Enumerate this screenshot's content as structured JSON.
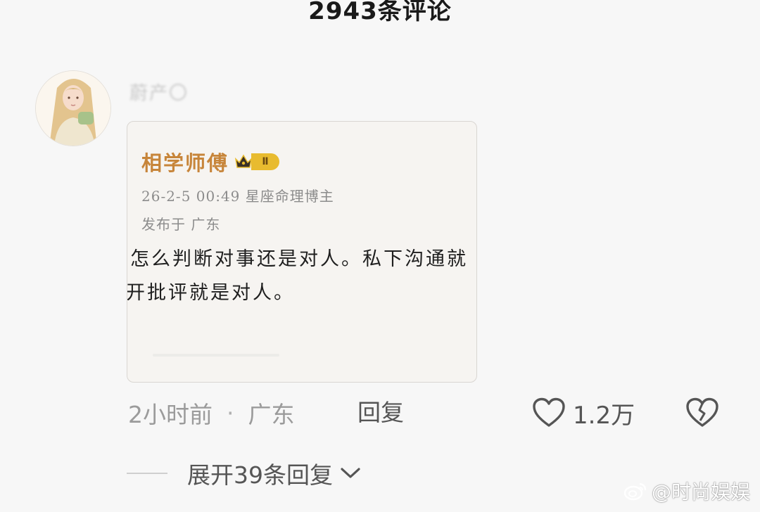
{
  "header": {
    "title": "2943条评论"
  },
  "comment": {
    "username": "蔚产〇",
    "screenshot": {
      "author": "相学师傅",
      "level_badge": "Ⅱ",
      "meta": "26-2-5 00:49  星座命理博主",
      "location": "发布于 广东",
      "text_line1": "怎么判断对事还是对人。私下沟通就",
      "text_line2": "开批评就是对人。"
    },
    "time": "2小时前",
    "separator": "·",
    "location": "广东",
    "reply_label": "回复",
    "like_count": "1.2万",
    "expand_label": "展开39条回复"
  },
  "watermark": {
    "text": "@时尚娱娱"
  },
  "icons": {
    "like": "heart-outline-icon",
    "dislike": "broken-heart-icon",
    "expand": "chevron-down-icon",
    "crown": "crown-icon",
    "weibo": "weibo-logo-icon"
  },
  "colors": {
    "inner_author": "#c7853a",
    "level_badge": "#e8bb2f",
    "meta_gray": "#9b9b9b",
    "action_gray": "#555555"
  }
}
